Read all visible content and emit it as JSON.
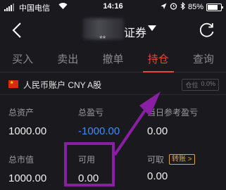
{
  "status_bar": {
    "carrier": "中国电信",
    "time": "14:16",
    "battery": "85%",
    "battery_level": 0.85
  },
  "nav": {
    "title_suffix": "证券",
    "title_prefix": "**"
  },
  "tabs": [
    {
      "label": "买入",
      "active": false
    },
    {
      "label": "卖出",
      "active": false
    },
    {
      "label": "撤单",
      "active": false
    },
    {
      "label": "持仓",
      "active": true
    },
    {
      "label": "查询",
      "active": false
    }
  ],
  "account": {
    "label": "人民币账户 CNY A股",
    "position_ratio_label": "仓位",
    "position_ratio": "0.0%"
  },
  "summary": {
    "total_assets": {
      "label": "总资产",
      "value": "1000.00"
    },
    "total_pnl": {
      "label": "总盈亏",
      "value": "-1000.00"
    },
    "today_pnl": {
      "label": "当日参考盈亏",
      "value": "0.00"
    },
    "market_value": {
      "label": "总市值",
      "value": "1000.00"
    },
    "available": {
      "label": "可用",
      "value": "0.00"
    },
    "withdrawable": {
      "label": "可取",
      "value": "0.00",
      "transfer": "转账"
    }
  },
  "colors": {
    "background": "#1a1a1e",
    "accent_red": "#e8463b",
    "negative_blue": "#3f8bff",
    "highlight_purple": "#8a1fa6",
    "transfer_gold": "#e0a63e"
  }
}
